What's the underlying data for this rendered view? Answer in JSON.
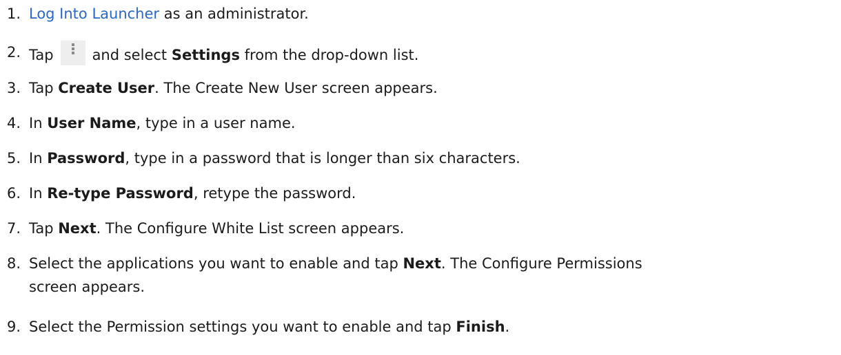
{
  "steps": [
    {
      "num": "1.",
      "link": "Log Into Launcher",
      "after": " as an administrator."
    },
    {
      "num": "2.",
      "before": "Tap",
      "icon": "overflow-menu-icon",
      "mid": "and select ",
      "bold": "Settings",
      "after": " from the drop-down list."
    },
    {
      "num": "3.",
      "before": "Tap ",
      "bold": "Create User",
      "after": ". The Create New User screen appears."
    },
    {
      "num": "4.",
      "before": "In ",
      "bold": "User Name",
      "after": ", type in a user name."
    },
    {
      "num": "5.",
      "before": "In ",
      "bold": "Password",
      "after": ", type in a password that is longer than six characters."
    },
    {
      "num": "6.",
      "before": "In ",
      "bold": "Re-type Password",
      "after": ", retype the password."
    },
    {
      "num": "7.",
      "before": "Tap ",
      "bold": "Next",
      "after": ". The Configure White List screen appears."
    },
    {
      "num": "8.",
      "before": "Select the applications you want to enable and tap ",
      "bold": "Next",
      "after": ". The Configure Permissions",
      "cont": "screen appears."
    },
    {
      "num": "9.",
      "before": "Select the Permission settings you want to enable and tap ",
      "bold": "Finish",
      "after": "."
    }
  ]
}
